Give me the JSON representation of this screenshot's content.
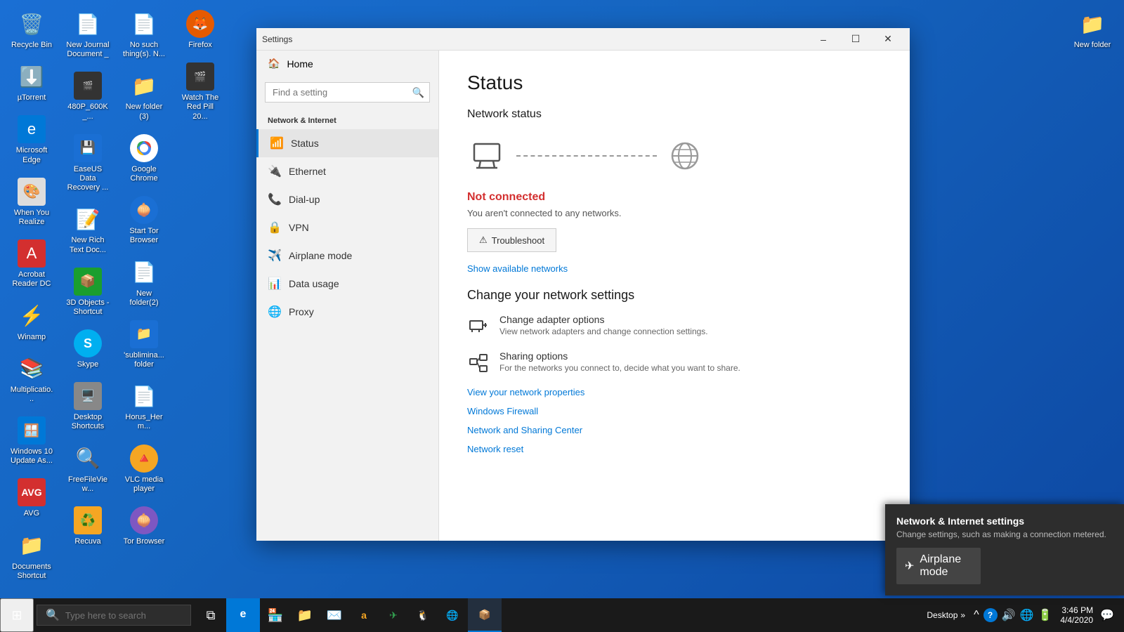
{
  "desktop": {
    "background_color": "#1565c0",
    "icons": [
      {
        "id": "recycle-bin",
        "label": "Recycle Bin",
        "emoji": "🗑️",
        "color": "#888"
      },
      {
        "id": "utorrent",
        "label": "µTorrent",
        "emoji": "⬇️",
        "color": "#1a9e2e"
      },
      {
        "id": "microsoft-edge",
        "label": "Microsoft Edge",
        "emoji": "🌐",
        "color": "#0078d7"
      },
      {
        "id": "when-you-realize",
        "label": "When You Realize",
        "emoji": "🎨",
        "color": "#e0e0e0"
      },
      {
        "id": "acrobat-reader",
        "label": "Acrobat Reader DC",
        "emoji": "📕",
        "color": "#d32f2f"
      },
      {
        "id": "winamp",
        "label": "Winamp",
        "emoji": "🎵",
        "color": "#f5f500"
      },
      {
        "id": "multiplication",
        "label": "Multiplicatio...",
        "emoji": "📊",
        "color": "#e0e0e0"
      },
      {
        "id": "windows-10-update",
        "label": "Windows 10 Update As...",
        "emoji": "🪟",
        "color": "#0078d7"
      },
      {
        "id": "avg",
        "label": "AVG",
        "emoji": "🛡️",
        "color": "#d32f2f"
      },
      {
        "id": "documents-shortcut",
        "label": "Documents Shortcut",
        "emoji": "📁",
        "color": "#f5a623"
      },
      {
        "id": "new-journal-doc",
        "label": "New Journal Document _",
        "emoji": "📄",
        "color": "#e0e0e0"
      },
      {
        "id": "480p-600k",
        "label": "480P_600K_...",
        "emoji": "🎬",
        "color": "#333"
      },
      {
        "id": "easeus-data",
        "label": "EaseUS Data Recovery ...",
        "emoji": "💾",
        "color": "#1a6fd4"
      },
      {
        "id": "new-rich-text",
        "label": "New Rich Text Doc...",
        "emoji": "📝",
        "color": "#e0e0e0"
      },
      {
        "id": "3d-objects",
        "label": "3D Objects - Shortcut",
        "emoji": "📦",
        "color": "#1a9e2e"
      },
      {
        "id": "skype",
        "label": "Skype",
        "emoji": "💬",
        "color": "#00aff0"
      },
      {
        "id": "desktop-shortcuts",
        "label": "Desktop Shortcuts",
        "emoji": "🖥️",
        "color": "#888"
      },
      {
        "id": "freefileview",
        "label": "FreeFileView...",
        "emoji": "🔍",
        "color": "#e0e0e0"
      },
      {
        "id": "recuva",
        "label": "Recuva",
        "emoji": "♻️",
        "color": "#f5a623"
      },
      {
        "id": "no-such-thing",
        "label": "No such thing(s). N...",
        "emoji": "📄",
        "color": "#e0e0e0"
      },
      {
        "id": "new-folder-3",
        "label": "New folder (3)",
        "emoji": "📁",
        "color": "#f5a623"
      },
      {
        "id": "google-chrome",
        "label": "Google Chrome",
        "emoji": "🌐",
        "color": "#fff"
      },
      {
        "id": "start-tor-browser",
        "label": "Start Tor Browser",
        "emoji": "🧅",
        "color": "#1a6fd4"
      },
      {
        "id": "new-folder-2",
        "label": "New folder(2)",
        "emoji": "📄",
        "color": "#e0e0e0"
      },
      {
        "id": "sublimina-folder",
        "label": "'sublimina... folder",
        "emoji": "📁",
        "color": "#1a6fd4"
      },
      {
        "id": "horus-herm",
        "label": "Horus_Herm...",
        "emoji": "📄",
        "color": "#e0e0e0"
      },
      {
        "id": "vlc-media-player",
        "label": "VLC media player",
        "emoji": "🔺",
        "color": "#f5a623"
      },
      {
        "id": "tor-browser",
        "label": "Tor Browser",
        "emoji": "🧅",
        "color": "#7e57c2"
      },
      {
        "id": "firefox",
        "label": "Firefox",
        "emoji": "🦊",
        "color": "#e55a00"
      },
      {
        "id": "watch-red-pill",
        "label": "Watch The Red Pill 20...",
        "emoji": "🎬",
        "color": "#333"
      }
    ],
    "top_right_icon": {
      "id": "new-folder-top",
      "label": "New folder",
      "emoji": "📁"
    }
  },
  "settings_window": {
    "title": "Settings",
    "sidebar": {
      "home_label": "Home",
      "search_placeholder": "Find a setting",
      "section_title": "Network & Internet",
      "items": [
        {
          "id": "status",
          "label": "Status",
          "icon": "📶",
          "active": true
        },
        {
          "id": "ethernet",
          "label": "Ethernet",
          "icon": "🔌"
        },
        {
          "id": "dial-up",
          "label": "Dial-up",
          "icon": "📞"
        },
        {
          "id": "vpn",
          "label": "VPN",
          "icon": "🔒"
        },
        {
          "id": "airplane-mode",
          "label": "Airplane mode",
          "icon": "✈️"
        },
        {
          "id": "data-usage",
          "label": "Data usage",
          "icon": "📊"
        },
        {
          "id": "proxy",
          "label": "Proxy",
          "icon": "🌐"
        }
      ]
    },
    "main": {
      "page_title": "Status",
      "network_status_title": "Network status",
      "connection_status": "Not connected",
      "connection_desc": "You aren't connected to any networks.",
      "troubleshoot_label": "⚠ Troubleshoot",
      "show_networks_link": "Show available networks",
      "change_settings_title": "Change your network settings",
      "options": [
        {
          "id": "adapter-options",
          "title": "Change adapter options",
          "desc": "View network adapters and change connection settings.",
          "icon": "🔌"
        },
        {
          "id": "sharing-options",
          "title": "Sharing options",
          "desc": "For the networks you connect to, decide what you want to share.",
          "icon": "🔗"
        }
      ],
      "links": [
        {
          "id": "network-properties",
          "label": "View your network properties"
        },
        {
          "id": "windows-firewall",
          "label": "Windows Firewall"
        },
        {
          "id": "network-sharing-center",
          "label": "Network and Sharing Center"
        },
        {
          "id": "network-reset",
          "label": "Network reset"
        }
      ]
    }
  },
  "taskbar": {
    "search_placeholder": "Type here to search",
    "app_icons": [
      {
        "id": "start-menu",
        "emoji": "⊞",
        "label": "Start"
      },
      {
        "id": "cortana",
        "emoji": "🔍",
        "label": "Search"
      },
      {
        "id": "task-view",
        "emoji": "⧉",
        "label": "Task View"
      },
      {
        "id": "edge-taskbar",
        "emoji": "🌐",
        "label": "Edge"
      },
      {
        "id": "store-taskbar",
        "emoji": "🏪",
        "label": "Store"
      },
      {
        "id": "explorer-taskbar",
        "emoji": "📁",
        "label": "File Explorer"
      },
      {
        "id": "mail-taskbar",
        "emoji": "✉️",
        "label": "Mail"
      },
      {
        "id": "amazon-taskbar",
        "emoji": "a",
        "label": "Amazon"
      },
      {
        "id": "tripadvisor-taskbar",
        "emoji": "✈",
        "label": "TripAdvisor"
      },
      {
        "id": "ubuntu-taskbar",
        "emoji": "🐧",
        "label": "Ubuntu"
      },
      {
        "id": "browser-taskbar",
        "emoji": "🌐",
        "label": "Browser"
      },
      {
        "id": "amazon2-taskbar",
        "emoji": "📦",
        "label": "Amazon"
      }
    ],
    "system_area": {
      "desktop_label": "Desktop",
      "chevron": "»",
      "help_icon": "?",
      "time": "3:46 PM",
      "date": "4/4/2020",
      "tray_icons": [
        "^",
        "🔊",
        "🔋"
      ]
    }
  },
  "notification": {
    "title": "Network & Internet settings",
    "desc": "Change settings, such as making a connection metered.",
    "airplane_mode_label": "Airplane mode",
    "airplane_icon": "✈"
  },
  "colors": {
    "accent": "#0078d7",
    "not_connected_red": "#d32f2f",
    "link_blue": "#0078d7",
    "taskbar_bg": "#1a1a1a",
    "window_bg": "#f2f2f2"
  }
}
